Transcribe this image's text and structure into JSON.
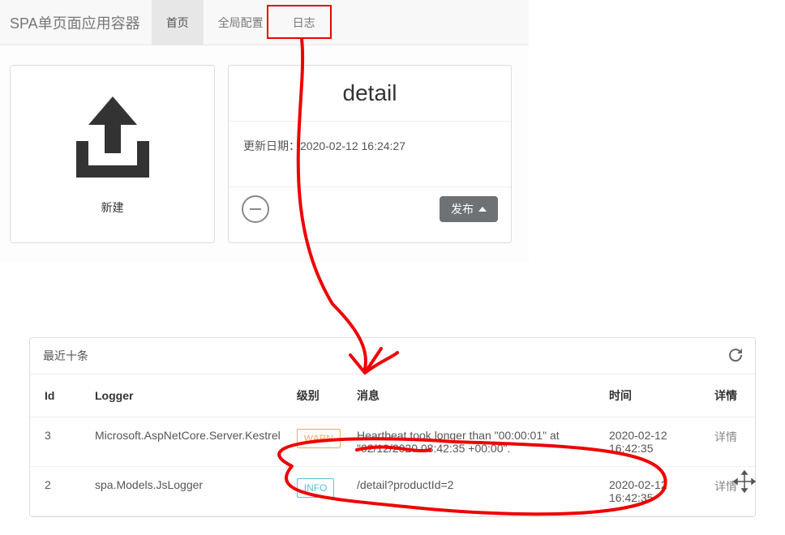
{
  "brand": "SPA单页面应用容器",
  "tabs": {
    "home": "首页",
    "global": "全局配置",
    "logs": "日志"
  },
  "cards": {
    "new_label": "新建",
    "detail": {
      "title": "detail",
      "meta_label": "更新日期：",
      "meta_value": "2020-02-12 16:24:27",
      "publish": "发布"
    }
  },
  "log": {
    "header": "最近十条",
    "cols": {
      "id": "Id",
      "logger": "Logger",
      "level": "级别",
      "msg": "消息",
      "time": "时间",
      "detail": "详情"
    },
    "rows": [
      {
        "id": "3",
        "logger": "Microsoft.AspNetCore.Server.Kestrel",
        "level": "WARN",
        "level_class": "warn",
        "msg": "Heartbeat took longer than \"00:00:01\" at \"02/12/2020 08:42:35 +00:00\".",
        "time": "2020-02-12 16:42:35",
        "detail": "详情"
      },
      {
        "id": "2",
        "logger": "spa.Models.JsLogger",
        "level": "INFO",
        "level_class": "info",
        "msg": "/detail?productId=2",
        "time": "2020-02-12 16:42:35",
        "detail": "详情"
      }
    ]
  }
}
